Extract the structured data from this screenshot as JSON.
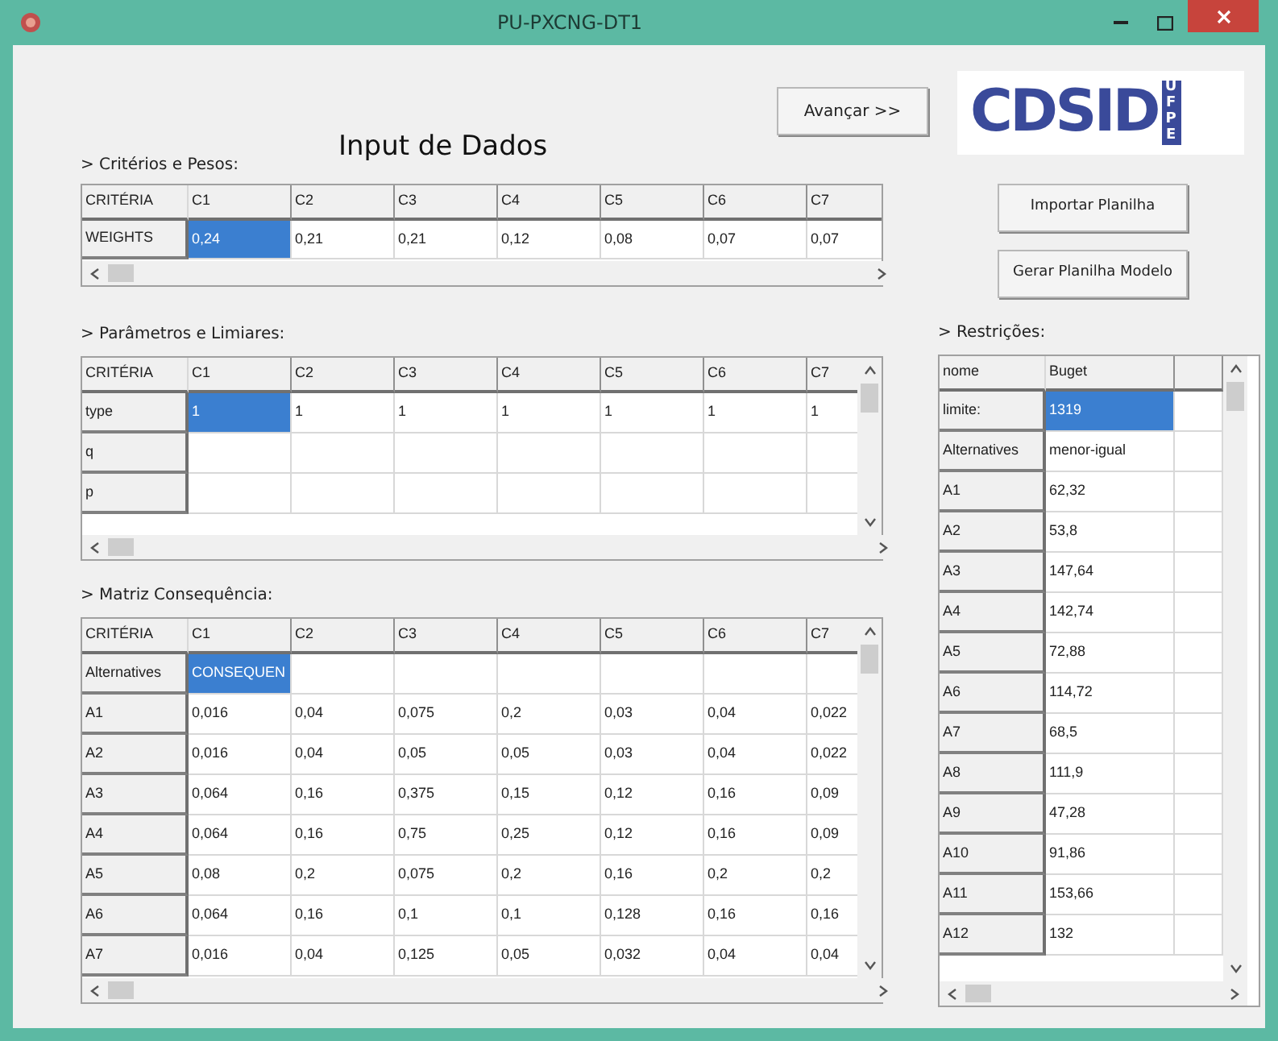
{
  "window": {
    "title": "PU-PXCNG-DT1"
  },
  "header": {
    "title": "Input de Dados",
    "next_button": "Avançar >>",
    "logo": {
      "main": "CDSID",
      "side": "UFPE"
    }
  },
  "actions": [
    "Importar Planilha",
    "Gerar Planilha Modelo"
  ],
  "criteria_weights": {
    "label": "> Critérios e Pesos:",
    "corner": "CRITÉRIA",
    "columns": [
      "C1",
      "C2",
      "C3",
      "C4",
      "C5",
      "C6",
      "C7"
    ],
    "rows": [
      {
        "header": "WEIGHTS",
        "cells": [
          {
            "text": "0,24",
            "selected": true
          },
          {
            "text": "0,21",
            "selected": false
          },
          {
            "text": "0,21",
            "selected": false
          },
          {
            "text": "0,12",
            "selected": false
          },
          {
            "text": "0,08",
            "selected": false
          },
          {
            "text": "0,07",
            "selected": false
          },
          {
            "text": "0,07",
            "selected": false
          }
        ]
      }
    ]
  },
  "parameters": {
    "label": "> Parâmetros e Limiares:",
    "corner": "CRITÉRIA",
    "columns": [
      "C1",
      "C2",
      "C3",
      "C4",
      "C5",
      "C6",
      "C7"
    ],
    "rows": [
      {
        "header": "type",
        "cells": [
          {
            "text": "1",
            "selected": true
          },
          {
            "text": "1",
            "selected": false
          },
          {
            "text": "1",
            "selected": false
          },
          {
            "text": "1",
            "selected": false
          },
          {
            "text": "1",
            "selected": false
          },
          {
            "text": "1",
            "selected": false
          },
          {
            "text": "1",
            "selected": false
          }
        ]
      },
      {
        "header": "q",
        "cells": []
      },
      {
        "header": "p",
        "cells": []
      }
    ]
  },
  "consequence_matrix": {
    "label": "> Matriz Consequência:",
    "corner": "CRITÉRIA",
    "columns": [
      "C1",
      "C2",
      "C3",
      "C4",
      "C5",
      "C6",
      "C7"
    ],
    "rows": [
      {
        "header": "Alternatives",
        "cells": [
          {
            "text": "CONSEQUEN",
            "selected": true
          }
        ]
      },
      {
        "header": "A1",
        "cells": [
          {
            "text": "0,016",
            "selected": false
          },
          {
            "text": "0,04",
            "selected": false
          },
          {
            "text": "0,075",
            "selected": false
          },
          {
            "text": "0,2",
            "selected": false
          },
          {
            "text": "0,03",
            "selected": false
          },
          {
            "text": "0,04",
            "selected": false
          },
          {
            "text": "0,022",
            "selected": false
          }
        ]
      },
      {
        "header": "A2",
        "cells": [
          {
            "text": "0,016",
            "selected": false
          },
          {
            "text": "0,04",
            "selected": false
          },
          {
            "text": "0,05",
            "selected": false
          },
          {
            "text": "0,05",
            "selected": false
          },
          {
            "text": "0,03",
            "selected": false
          },
          {
            "text": "0,04",
            "selected": false
          },
          {
            "text": "0,022",
            "selected": false
          }
        ]
      },
      {
        "header": "A3",
        "cells": [
          {
            "text": "0,064",
            "selected": false
          },
          {
            "text": "0,16",
            "selected": false
          },
          {
            "text": "0,375",
            "selected": false
          },
          {
            "text": "0,15",
            "selected": false
          },
          {
            "text": "0,12",
            "selected": false
          },
          {
            "text": "0,16",
            "selected": false
          },
          {
            "text": "0,09",
            "selected": false
          }
        ]
      },
      {
        "header": "A4",
        "cells": [
          {
            "text": "0,064",
            "selected": false
          },
          {
            "text": "0,16",
            "selected": false
          },
          {
            "text": "0,75",
            "selected": false
          },
          {
            "text": "0,25",
            "selected": false
          },
          {
            "text": "0,12",
            "selected": false
          },
          {
            "text": "0,16",
            "selected": false
          },
          {
            "text": "0,09",
            "selected": false
          }
        ]
      },
      {
        "header": "A5",
        "cells": [
          {
            "text": "0,08",
            "selected": false
          },
          {
            "text": "0,2",
            "selected": false
          },
          {
            "text": "0,075",
            "selected": false
          },
          {
            "text": "0,2",
            "selected": false
          },
          {
            "text": "0,16",
            "selected": false
          },
          {
            "text": "0,2",
            "selected": false
          },
          {
            "text": "0,2",
            "selected": false
          }
        ]
      },
      {
        "header": "A6",
        "cells": [
          {
            "text": "0,064",
            "selected": false
          },
          {
            "text": "0,16",
            "selected": false
          },
          {
            "text": "0,1",
            "selected": false
          },
          {
            "text": "0,1",
            "selected": false
          },
          {
            "text": "0,128",
            "selected": false
          },
          {
            "text": "0,16",
            "selected": false
          },
          {
            "text": "0,16",
            "selected": false
          }
        ]
      },
      {
        "header": "A7",
        "cells": [
          {
            "text": "0,016",
            "selected": false
          },
          {
            "text": "0,04",
            "selected": false
          },
          {
            "text": "0,125",
            "selected": false
          },
          {
            "text": "0,05",
            "selected": false
          },
          {
            "text": "0,032",
            "selected": false
          },
          {
            "text": "0,04",
            "selected": false
          },
          {
            "text": "0,04",
            "selected": false
          }
        ]
      }
    ]
  },
  "restrictions": {
    "label": "> Restrições:",
    "corner": "nome",
    "columns": [
      "Buget"
    ],
    "rows": [
      {
        "header": "limite:",
        "cells": [
          {
            "text": "1319",
            "selected": true
          }
        ]
      },
      {
        "header": "Alternatives",
        "cells": [
          {
            "text": "menor-igual",
            "selected": false
          }
        ]
      },
      {
        "header": "A1",
        "cells": [
          {
            "text": "62,32",
            "selected": false
          }
        ]
      },
      {
        "header": "A2",
        "cells": [
          {
            "text": "53,8",
            "selected": false
          }
        ]
      },
      {
        "header": "A3",
        "cells": [
          {
            "text": "147,64",
            "selected": false
          }
        ]
      },
      {
        "header": "A4",
        "cells": [
          {
            "text": "142,74",
            "selected": false
          }
        ]
      },
      {
        "header": "A5",
        "cells": [
          {
            "text": "72,88",
            "selected": false
          }
        ]
      },
      {
        "header": "A6",
        "cells": [
          {
            "text": "114,72",
            "selected": false
          }
        ]
      },
      {
        "header": "A7",
        "cells": [
          {
            "text": "68,5",
            "selected": false
          }
        ]
      },
      {
        "header": "A8",
        "cells": [
          {
            "text": "111,9",
            "selected": false
          }
        ]
      },
      {
        "header": "A9",
        "cells": [
          {
            "text": "47,28",
            "selected": false
          }
        ]
      },
      {
        "header": "A10",
        "cells": [
          {
            "text": "91,86",
            "selected": false
          }
        ]
      },
      {
        "header": "A11",
        "cells": [
          {
            "text": "153,66",
            "selected": false
          }
        ]
      },
      {
        "header": "A12",
        "cells": [
          {
            "text": "132",
            "selected": false
          }
        ]
      }
    ]
  }
}
